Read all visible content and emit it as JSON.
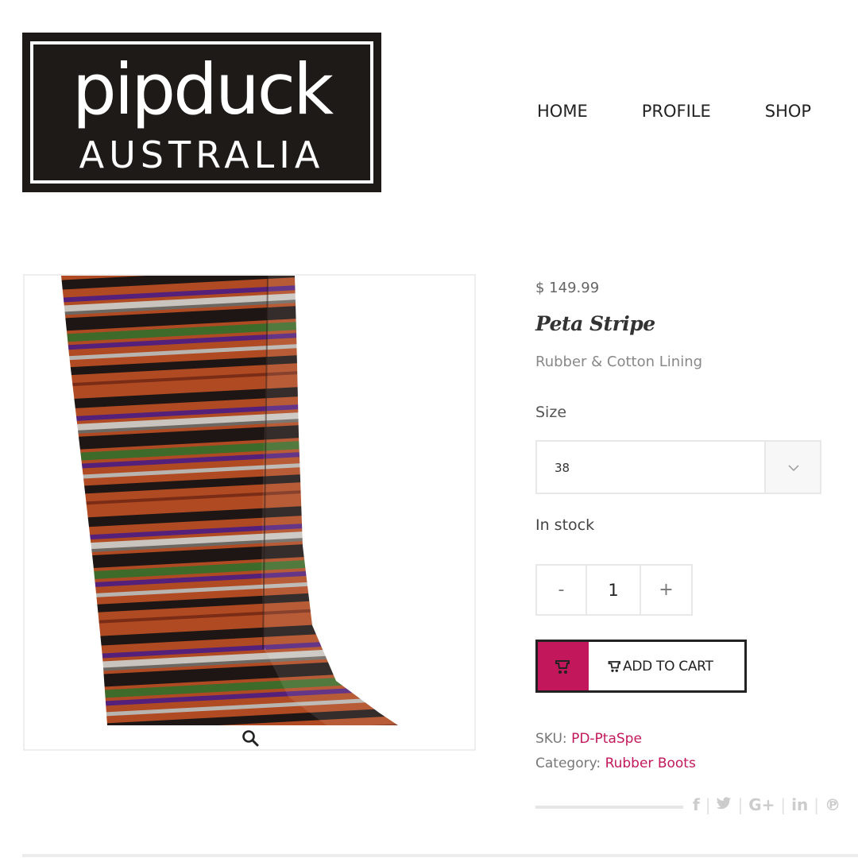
{
  "logo": {
    "main": "pipduck",
    "sub": "AUSTRALIA"
  },
  "nav": [
    {
      "label": "HOME"
    },
    {
      "label": "PROFILE"
    },
    {
      "label": "SHOP"
    }
  ],
  "product": {
    "price": "$ 149.99",
    "title": "Peta Stripe",
    "subtitle": "Rubber & Cotton Lining",
    "size_label": "Size",
    "size_value": "38",
    "stock": "In stock",
    "quantity": "1",
    "qty_minus": "-",
    "qty_plus": "+",
    "add_to_cart": "ADD TO CART",
    "sku_label": "SKU:",
    "sku_value": "PD-PtaSpe",
    "category_label": "Category:",
    "category_value": "Rubber Boots"
  },
  "share": [
    {
      "icon": "facebook-icon",
      "glyph": "f"
    },
    {
      "icon": "twitter-icon",
      "glyph": "🐦"
    },
    {
      "icon": "google-plus-icon",
      "glyph": "G+"
    },
    {
      "icon": "linkedin-icon",
      "glyph": "in"
    },
    {
      "icon": "pinterest-icon",
      "glyph": "℗"
    }
  ],
  "colors": {
    "accent": "#c2185b",
    "logo_bg": "#1e1a18",
    "stripe_rust": "#b04a22",
    "stripe_black": "#1e1614",
    "stripe_purple": "#54207a",
    "stripe_green": "#3f6b2a",
    "stripe_grey": "#b8b4b0"
  }
}
